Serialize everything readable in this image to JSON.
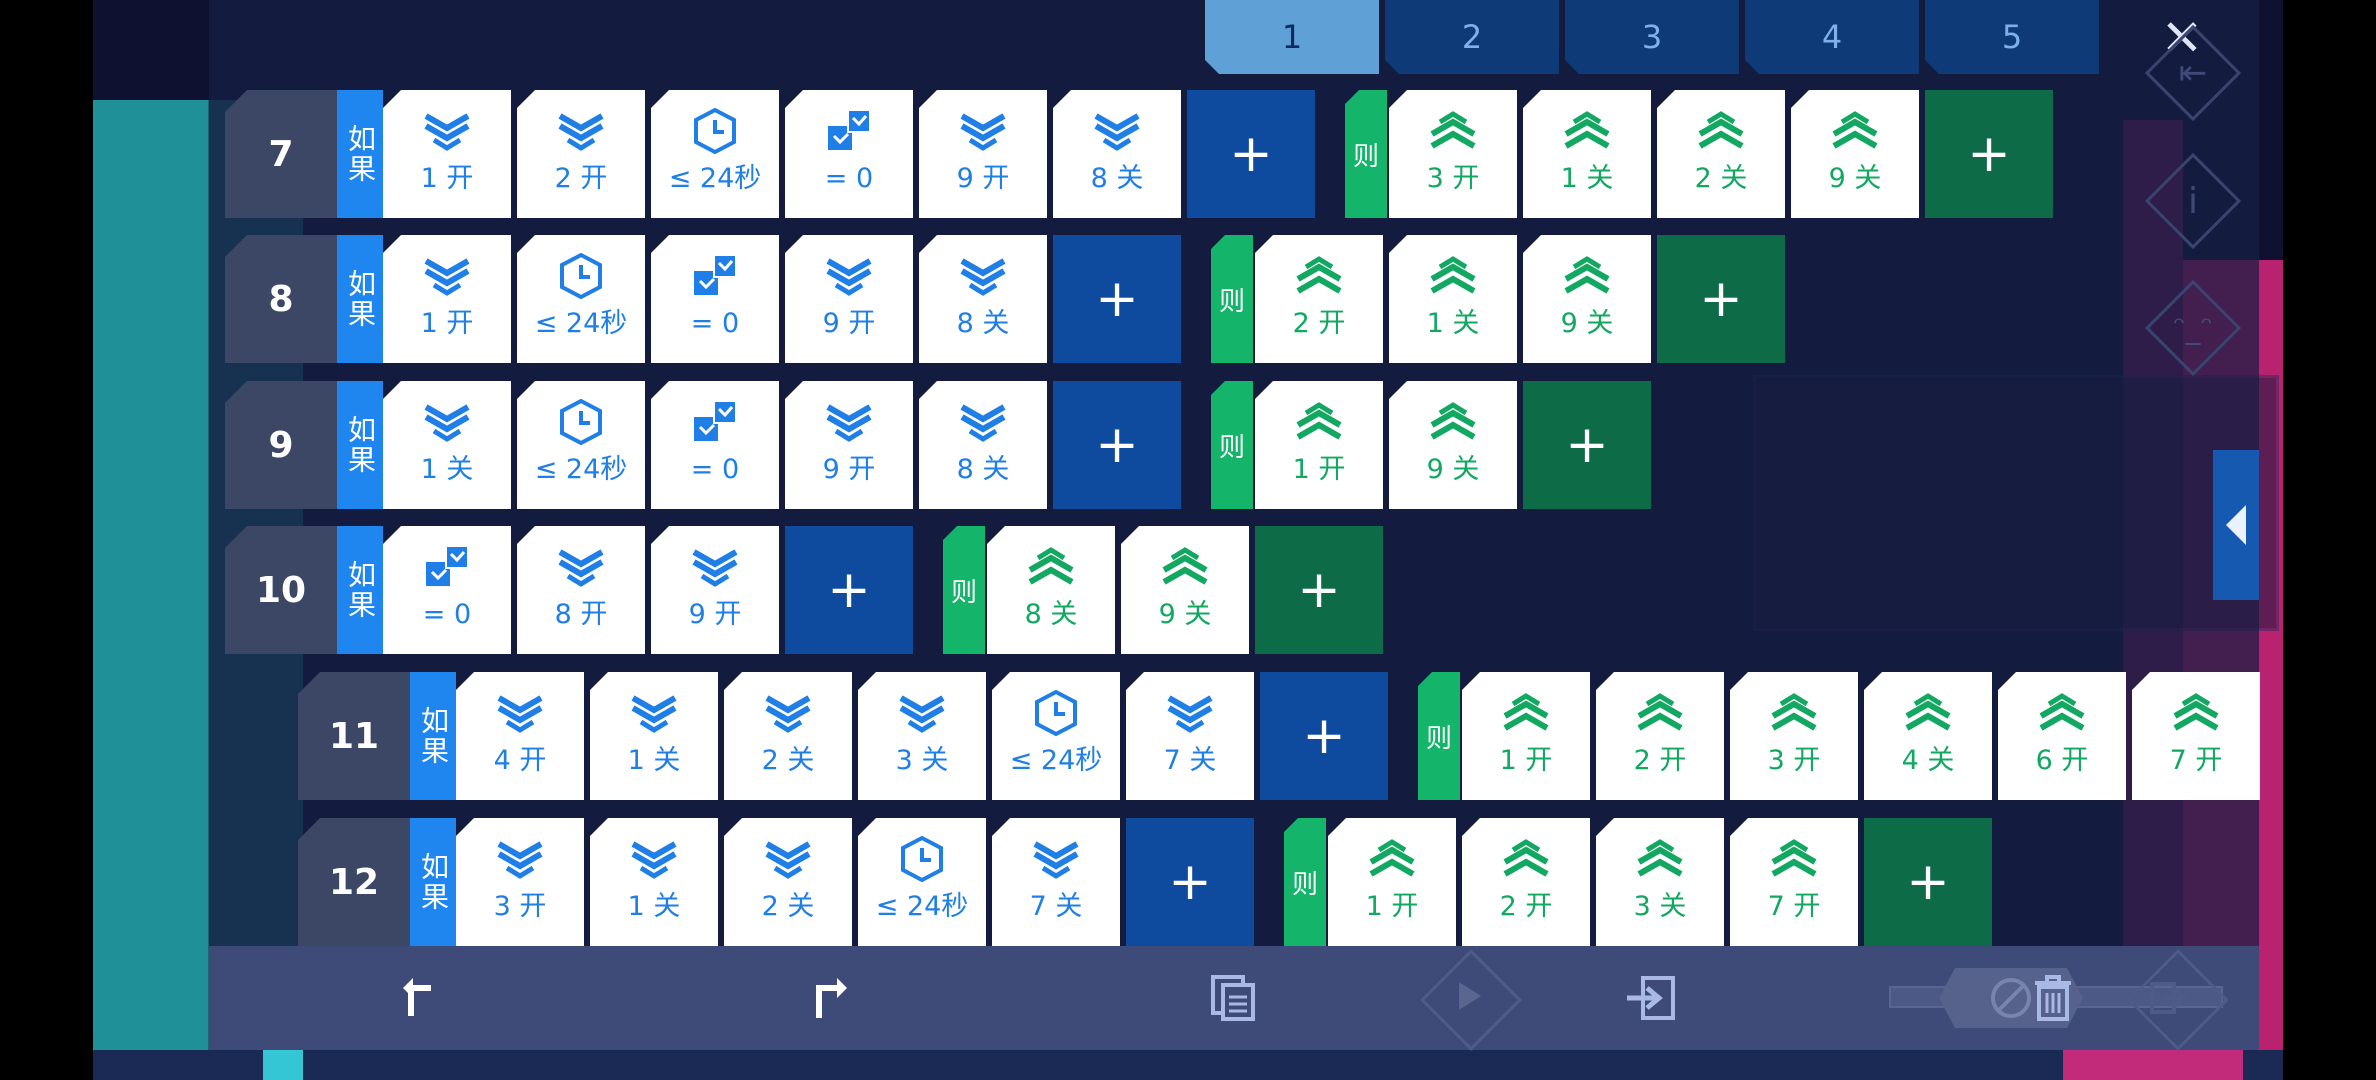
{
  "tabs": [
    "1",
    "2",
    "3",
    "4",
    "5"
  ],
  "active_tab": "1",
  "close_label": "✕",
  "if_label": "如果",
  "then_label": "则",
  "add_label": "+",
  "colors": {
    "condition_blue": "#1f7fe6",
    "action_green": "#12a862",
    "add_blue": "#0e4a9e",
    "add_green": "#0d6b47"
  },
  "rules": [
    {
      "number": "7",
      "conditions": [
        {
          "icon": "stack-icon",
          "label": "1 开"
        },
        {
          "icon": "stack-icon",
          "label": "2 开"
        },
        {
          "icon": "clock-icon",
          "label": "≤ 24秒"
        },
        {
          "icon": "crate-icon",
          "label": "= 0"
        },
        {
          "icon": "stack-icon",
          "label": "9 开"
        },
        {
          "icon": "stack-icon",
          "label": "8 关"
        }
      ],
      "actions": [
        {
          "icon": "signal-icon",
          "label": "3 开"
        },
        {
          "icon": "signal-icon",
          "label": "1 关"
        },
        {
          "icon": "signal-icon",
          "label": "2 关"
        },
        {
          "icon": "signal-icon",
          "label": "9 关"
        }
      ]
    },
    {
      "number": "8",
      "conditions": [
        {
          "icon": "stack-icon",
          "label": "1 开"
        },
        {
          "icon": "clock-icon",
          "label": "≤ 24秒"
        },
        {
          "icon": "crate-icon",
          "label": "= 0"
        },
        {
          "icon": "stack-icon",
          "label": "9 开"
        },
        {
          "icon": "stack-icon",
          "label": "8 关"
        }
      ],
      "actions": [
        {
          "icon": "signal-icon",
          "label": "2 开"
        },
        {
          "icon": "signal-icon",
          "label": "1 关"
        },
        {
          "icon": "signal-icon",
          "label": "9 关"
        }
      ]
    },
    {
      "number": "9",
      "conditions": [
        {
          "icon": "stack-icon",
          "label": "1 关"
        },
        {
          "icon": "clock-icon",
          "label": "≤ 24秒"
        },
        {
          "icon": "crate-icon",
          "label": "= 0"
        },
        {
          "icon": "stack-icon",
          "label": "9 开"
        },
        {
          "icon": "stack-icon",
          "label": "8 关"
        }
      ],
      "actions": [
        {
          "icon": "signal-icon",
          "label": "1 开"
        },
        {
          "icon": "signal-icon",
          "label": "9 关"
        }
      ]
    },
    {
      "number": "10",
      "conditions": [
        {
          "icon": "crate-icon",
          "label": "= 0"
        },
        {
          "icon": "stack-icon",
          "label": "8 开"
        },
        {
          "icon": "stack-icon",
          "label": "9 开"
        }
      ],
      "actions": [
        {
          "icon": "signal-icon",
          "label": "8 关"
        },
        {
          "icon": "signal-icon",
          "label": "9 关"
        }
      ]
    },
    {
      "number": "11",
      "conditions": [
        {
          "icon": "stack-icon",
          "label": "4 开"
        },
        {
          "icon": "stack-icon",
          "label": "1 关"
        },
        {
          "icon": "stack-icon",
          "label": "2 关"
        },
        {
          "icon": "stack-icon",
          "label": "3 关"
        },
        {
          "icon": "clock-icon",
          "label": "≤ 24秒"
        },
        {
          "icon": "stack-icon",
          "label": "7 关"
        }
      ],
      "actions": [
        {
          "icon": "signal-icon",
          "label": "1 开"
        },
        {
          "icon": "signal-icon",
          "label": "2 开"
        },
        {
          "icon": "signal-icon",
          "label": "3 开"
        },
        {
          "icon": "signal-icon",
          "label": "4 关"
        },
        {
          "icon": "signal-icon",
          "label": "6 开"
        },
        {
          "icon": "signal-icon",
          "label": "7 开"
        }
      ]
    },
    {
      "number": "12",
      "conditions": [
        {
          "icon": "stack-icon",
          "label": "3 开"
        },
        {
          "icon": "stack-icon",
          "label": "1 关"
        },
        {
          "icon": "stack-icon",
          "label": "2 关"
        },
        {
          "icon": "clock-icon",
          "label": "≤ 24秒"
        },
        {
          "icon": "stack-icon",
          "label": "7 关"
        }
      ],
      "actions": [
        {
          "icon": "signal-icon",
          "label": "1 开"
        },
        {
          "icon": "signal-icon",
          "label": "2 开"
        },
        {
          "icon": "signal-icon",
          "label": "3 关"
        },
        {
          "icon": "signal-icon",
          "label": "7 开"
        }
      ]
    }
  ],
  "toolbar": {
    "undo_icon": "undo-icon",
    "redo_icon": "redo-icon",
    "copy_icon": "copy-icon",
    "play_icon": "play-icon",
    "import_icon": "import-icon",
    "disable_icon": "disable-icon",
    "delete_icon": "trash-icon",
    "export_icon": "export-icon"
  }
}
